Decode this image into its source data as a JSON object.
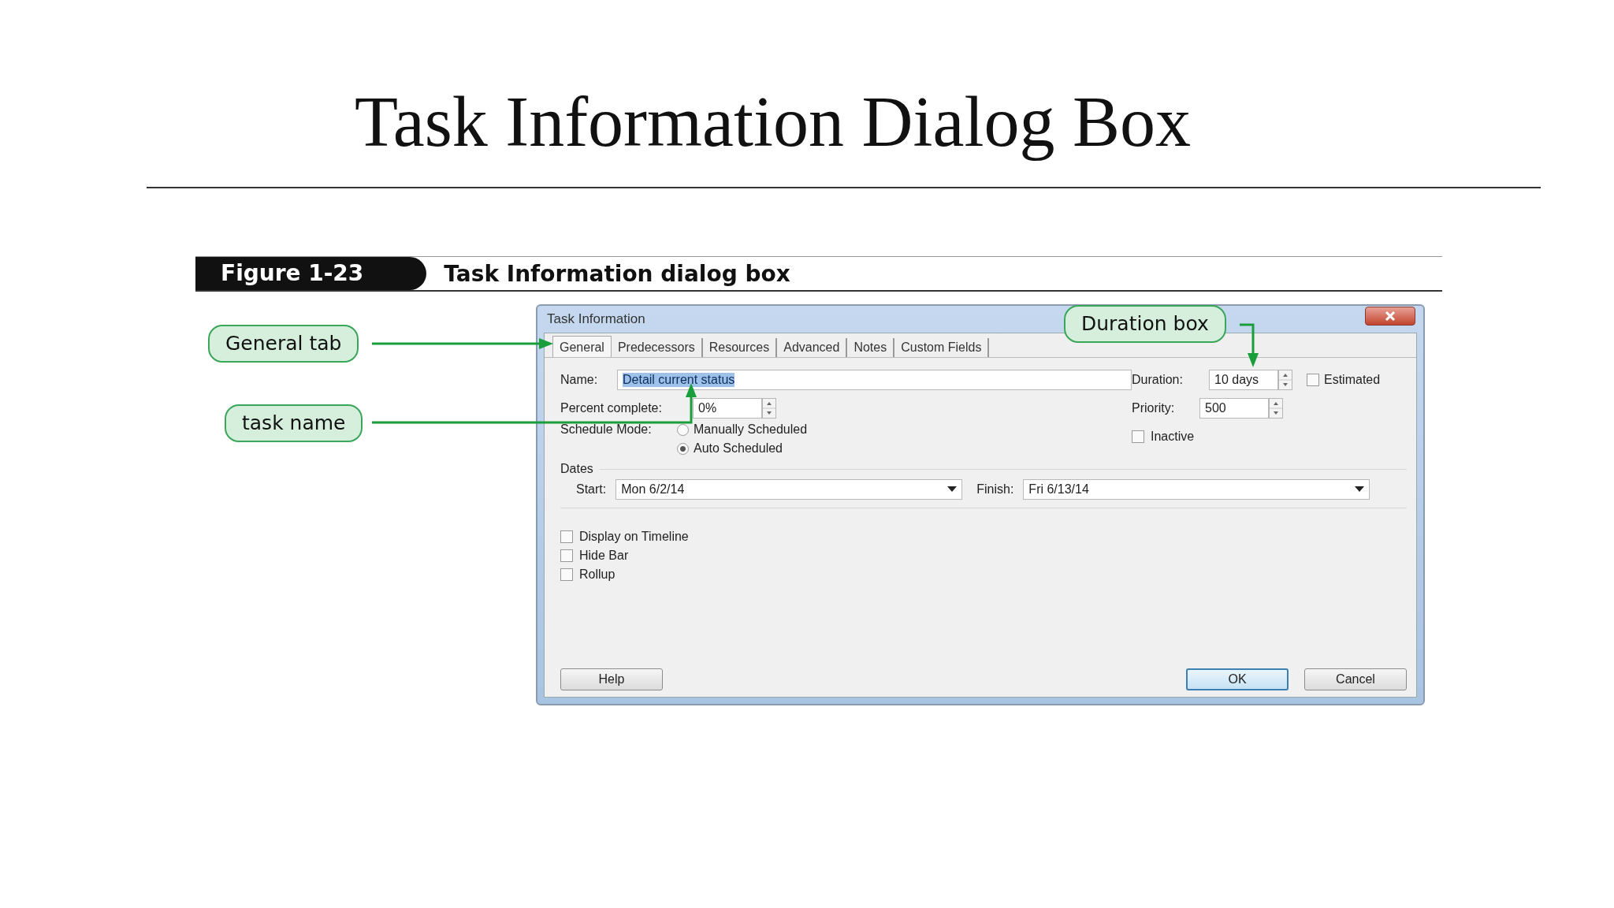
{
  "slide_title": "Task Information Dialog Box",
  "figure": {
    "number": "Figure 1-23",
    "caption": "Task Information dialog box"
  },
  "callouts": [
    {
      "text": "General tab",
      "kind": "tab"
    },
    {
      "text": "task name",
      "kind": "name"
    },
    {
      "text": "Duration box",
      "kind": "duration"
    }
  ],
  "dialog": {
    "title": "Task Information",
    "tabs": [
      {
        "label": "General",
        "selected": true
      },
      {
        "label": "Predecessors",
        "selected": false
      },
      {
        "label": "Resources",
        "selected": false
      },
      {
        "label": "Advanced",
        "selected": false
      },
      {
        "label": "Notes",
        "selected": false
      },
      {
        "label": "Custom Fields",
        "selected": false
      }
    ],
    "name": {
      "label": "Name:",
      "value": "Detail current status",
      "text_selected": true
    },
    "percent_complete": {
      "label": "Percent complete:",
      "value": "0%"
    },
    "schedule_mode": {
      "label": "Schedule Mode:",
      "options": [
        {
          "label": "Manually Scheduled",
          "selected": false
        },
        {
          "label": "Auto Scheduled",
          "selected": true
        }
      ]
    },
    "duration": {
      "label": "Duration:",
      "value": "10 days"
    },
    "estimated": {
      "label": "Estimated",
      "checked": false
    },
    "priority": {
      "label": "Priority:",
      "value": "500"
    },
    "inactive": {
      "label": "Inactive",
      "checked": false
    },
    "dates": {
      "label": "Dates",
      "start": {
        "label": "Start:",
        "value": "Mon 6/2/14"
      },
      "finish": {
        "label": "Finish:",
        "value": "Fri 6/13/14"
      }
    },
    "options": [
      {
        "label": "Display on Timeline",
        "checked": false
      },
      {
        "label": "Hide Bar",
        "checked": false
      },
      {
        "label": "Rollup",
        "checked": false
      }
    ],
    "buttons": [
      {
        "label": "Help",
        "kind": "help",
        "default": false
      },
      {
        "label": "OK",
        "kind": "ok",
        "default": true
      },
      {
        "label": "Cancel",
        "kind": "cancel",
        "default": false
      }
    ]
  }
}
